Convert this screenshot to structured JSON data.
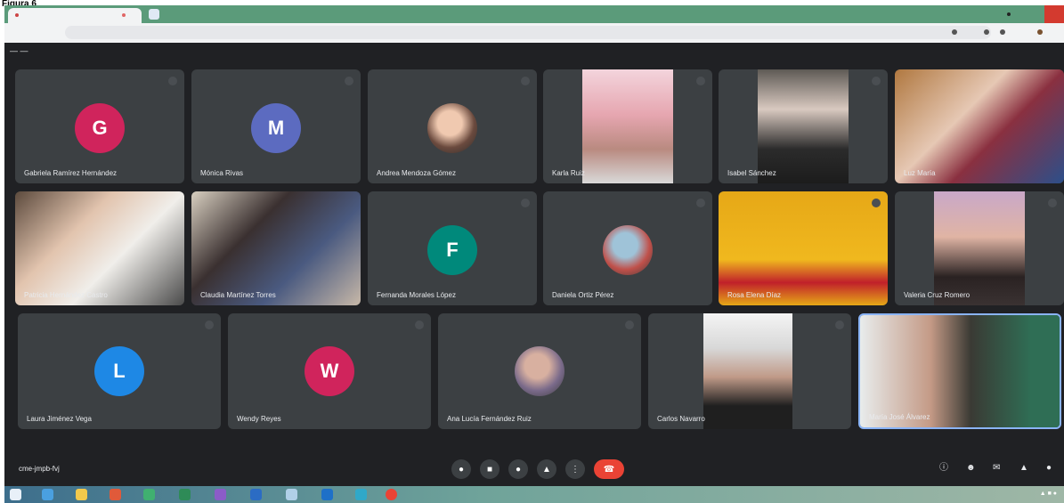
{
  "caption": "Figura 6",
  "meeting": {
    "code": "cme-jmpb-fvj"
  },
  "participants": [
    {
      "name": "Gabriela Ramírez Hernández",
      "type": "avatar",
      "initial": "G",
      "color": "#d0245c"
    },
    {
      "name": "Mónica Rivas",
      "type": "avatar",
      "initial": "M",
      "color": "#5c6bc0"
    },
    {
      "name": "Andrea Mendoza Gómez",
      "type": "photo"
    },
    {
      "name": "Karla Ruiz",
      "type": "video"
    },
    {
      "name": "Isabel Sánchez",
      "type": "video"
    },
    {
      "name": "Luz María",
      "type": "video"
    },
    {
      "name": "Patricia Hernández Castro",
      "type": "video"
    },
    {
      "name": "Claudia Martínez Torres",
      "type": "video"
    },
    {
      "name": "Fernanda Morales López",
      "type": "avatar",
      "initial": "F",
      "color": "#00897b"
    },
    {
      "name": "Daniela Ortiz Pérez",
      "type": "photo"
    },
    {
      "name": "Rosa Elena Díaz",
      "type": "video"
    },
    {
      "name": "Valeria Cruz Romero",
      "type": "video"
    },
    {
      "name": "Laura Jiménez Vega",
      "type": "avatar",
      "initial": "L",
      "color": "#1e88e5"
    },
    {
      "name": "Wendy Reyes",
      "type": "avatar",
      "initial": "W",
      "color": "#d0245c"
    },
    {
      "name": "Ana Lucía Fernández Ruiz",
      "type": "photo"
    },
    {
      "name": "Carlos Navarro",
      "type": "video"
    },
    {
      "name": "María José Álvarez",
      "type": "video"
    }
  ],
  "controls": [
    "mic",
    "camera",
    "captions",
    "present",
    "more",
    "hangup"
  ],
  "colors": {
    "meet_bg": "#202124",
    "tile": "#3c4043",
    "hangup": "#ea4335"
  }
}
